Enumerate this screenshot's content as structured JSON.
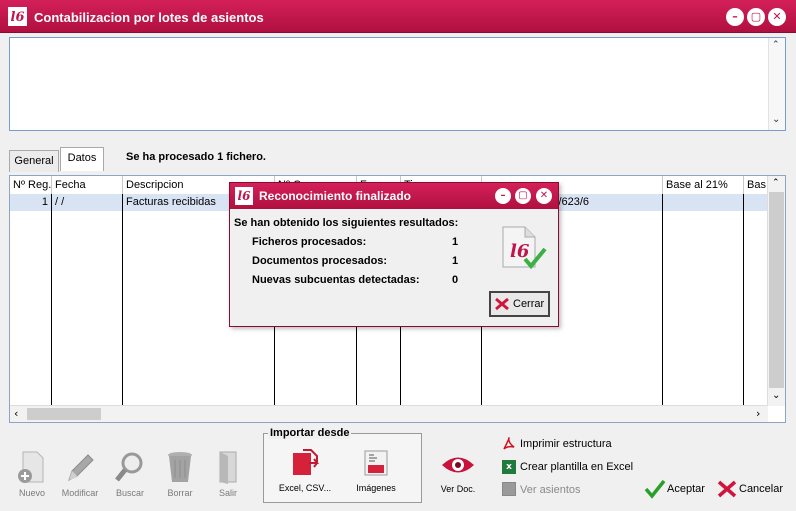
{
  "window": {
    "title": "Contabilizacion por lotes de asientos",
    "logo": "l6"
  },
  "tabs": [
    {
      "label": "General"
    },
    {
      "label": "Datos"
    }
  ],
  "status_text": "Se ha procesado 1 fichero.",
  "grid": {
    "columns": [
      "Nº Reg.",
      "Fecha",
      "Descripcion",
      "Nº C",
      "Fe",
      "Ti",
      "Base al  21%",
      "Bas"
    ],
    "rows": [
      {
        "nreg": "1",
        "fecha": "/  /",
        "descripcion": "Facturas recibidas",
        "cuentas": "01/620/621/622/623/6"
      }
    ]
  },
  "toolbar": {
    "nuevo": "Nuevo",
    "modificar": "Modificar",
    "buscar": "Buscar",
    "borrar": "Borrar",
    "salir": "Salir"
  },
  "import": {
    "title": "Importar desde",
    "excel": "Excel, CSV...",
    "imagenes": "Imágenes"
  },
  "ver_doc": "Ver Doc.",
  "links": {
    "imprimir": "Imprimir estructura",
    "plantilla": "Crear plantilla en Excel",
    "ver_asientos": "Ver asientos"
  },
  "actions": {
    "aceptar": "Aceptar",
    "cancelar": "Cancelar"
  },
  "dialog": {
    "title": "Reconocimiento finalizado",
    "heading": "Se han obtenido los siguientes resultados:",
    "results": [
      {
        "label": "Ficheros procesados:",
        "value": "1"
      },
      {
        "label": "Documentos procesados:",
        "value": "1"
      },
      {
        "label": "Nuevas subcuentas detectadas:",
        "value": "0"
      }
    ],
    "close": "Cerrar"
  },
  "colors": {
    "brand": "#c0144a",
    "selected_row": "#d8e4f4"
  }
}
